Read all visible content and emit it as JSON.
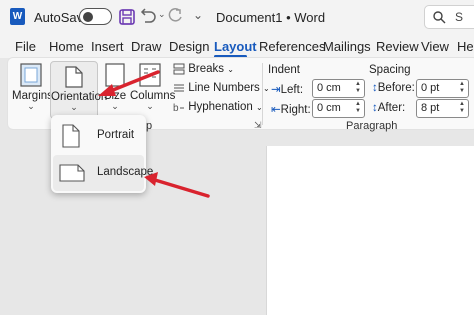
{
  "titlebar": {
    "autosave_label": "AutoSave",
    "doc_title": "Document1 • Word",
    "search_placeholder": "S"
  },
  "tabs": [
    {
      "label": "File",
      "active": false
    },
    {
      "label": "Home",
      "active": false
    },
    {
      "label": "Insert",
      "active": false
    },
    {
      "label": "Draw",
      "active": false
    },
    {
      "label": "Design",
      "active": false
    },
    {
      "label": "Layout",
      "active": true
    },
    {
      "label": "References",
      "active": false
    },
    {
      "label": "Mailings",
      "active": false
    },
    {
      "label": "Review",
      "active": false
    },
    {
      "label": "View",
      "active": false
    },
    {
      "label": "Help",
      "active": false
    }
  ],
  "ribbon": {
    "margins": "Margins",
    "orientation": "Orientation",
    "size": "Size",
    "columns": "Columns",
    "breaks": "Breaks",
    "line_numbers": "Line Numbers",
    "hyphenation": "Hyphenation",
    "page_setup_group_label": "Page Setup",
    "page_setup_group_visible": "p",
    "indent_head": "Indent",
    "spacing_head": "Spacing",
    "left_label": "Left:",
    "right_label": "Right:",
    "before_label": "Before:",
    "after_label": "After:",
    "left_value": "0 cm",
    "right_value": "0 cm",
    "before_value": "0 pt",
    "after_value": "8 pt",
    "paragraph_group_label": "Paragraph"
  },
  "orientation_menu": {
    "items": [
      "Portrait",
      "Landscape"
    ],
    "highlighted": "Landscape"
  },
  "annotation_color": "#d9232e",
  "accent_color": "#185abd"
}
